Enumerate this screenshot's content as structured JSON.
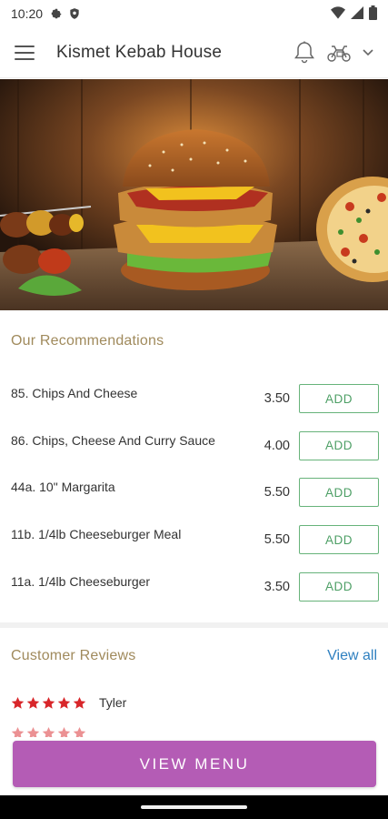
{
  "status_bar": {
    "time": "10:20",
    "left_icons": [
      "gear-icon",
      "shield-icon"
    ],
    "right_icons": [
      "wifi-icon",
      "signal-icon",
      "battery-icon"
    ]
  },
  "app_bar": {
    "title": "Kismet Kebab House",
    "icons": [
      "menu-icon",
      "bell-icon",
      "scooter-icon",
      "chevron-down-icon"
    ]
  },
  "hero": {
    "image": "banner of kebab skewers, fried chicken burger and pizza on wooden table"
  },
  "recommendations": {
    "title": "Our Recommendations",
    "items": [
      {
        "name": "85. Chips And Cheese",
        "price": "3.50",
        "action": "ADD"
      },
      {
        "name": "86. Chips, Cheese And Curry Sauce",
        "price": "4.00",
        "action": "ADD"
      },
      {
        "name": "44a. 10\" Margarita",
        "price": "5.50",
        "action": "ADD"
      },
      {
        "name": "11b. 1/4lb Cheeseburger Meal",
        "price": "5.50",
        "action": "ADD"
      },
      {
        "name": "11a. 1/4lb Cheeseburger",
        "price": "3.50",
        "action": "ADD"
      }
    ]
  },
  "reviews": {
    "title": "Customer Reviews",
    "view_all": "View all",
    "items": [
      {
        "reviewer": "Tyler",
        "rating": 5
      }
    ]
  },
  "cta": {
    "label": "VIEW MENU"
  },
  "colors": {
    "accent_gold": "#a08a5c",
    "add_green": "#4d9f65",
    "link_blue": "#2f80c0",
    "cta_purple": "#b45cb5",
    "star_red": "#d8262a"
  }
}
